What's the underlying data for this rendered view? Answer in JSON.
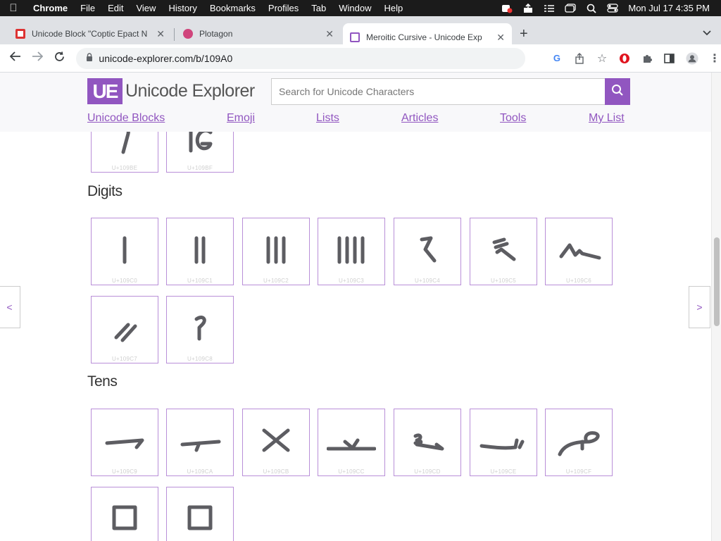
{
  "menubar": {
    "app_name": "Chrome",
    "items": [
      "File",
      "Edit",
      "View",
      "History",
      "Bookmarks",
      "Profiles",
      "Tab",
      "Window",
      "Help"
    ],
    "clock": "Mon Jul 17  4:35 PM"
  },
  "tabs": [
    {
      "title": "Unicode Block \"Coptic Epact N",
      "favicon_color": "#d33",
      "active": false
    },
    {
      "title": "Plotagon",
      "favicon_color": "#d0457c",
      "active": false
    },
    {
      "title": "Meroitic Cursive - Unicode Exp",
      "favicon_color": "#9156c0",
      "active": true
    }
  ],
  "toolbar": {
    "url": "unicode-explorer.com/b/109A0"
  },
  "site": {
    "logo_mark": "UE",
    "logo_text": "Unicode Explorer",
    "search_placeholder": "Search for Unicode Characters",
    "nav": [
      "Unicode Blocks",
      "Emoji",
      "Lists",
      "Articles",
      "Tools",
      "My List"
    ],
    "accent_color": "#9156c0"
  },
  "prev_row": {
    "cells": [
      {
        "code": "U+109BE",
        "glyph": "curl-p"
      },
      {
        "code": "U+109BF",
        "glyph": "ig"
      }
    ]
  },
  "digits": {
    "heading": "Digits",
    "cells": [
      {
        "code": "U+109C0",
        "glyph": "one"
      },
      {
        "code": "U+109C1",
        "glyph": "two"
      },
      {
        "code": "U+109C2",
        "glyph": "three"
      },
      {
        "code": "U+109C3",
        "glyph": "four"
      },
      {
        "code": "U+109C4",
        "glyph": "five"
      },
      {
        "code": "U+109C5",
        "glyph": "six"
      },
      {
        "code": "U+109C6",
        "glyph": "seven"
      },
      {
        "code": "U+109C7",
        "glyph": "eight"
      },
      {
        "code": "U+109C8",
        "glyph": "nine"
      }
    ]
  },
  "tens": {
    "heading": "Tens",
    "cells": [
      {
        "code": "U+109C9",
        "glyph": "ten"
      },
      {
        "code": "U+109CA",
        "glyph": "twenty"
      },
      {
        "code": "U+109CB",
        "glyph": "thirty"
      },
      {
        "code": "U+109CC",
        "glyph": "forty"
      },
      {
        "code": "U+109CD",
        "glyph": "fifty"
      },
      {
        "code": "U+109CE",
        "glyph": "sixty"
      },
      {
        "code": "U+109CF",
        "glyph": "seventy"
      },
      {
        "code": "",
        "glyph": "square"
      },
      {
        "code": "",
        "glyph": "square"
      }
    ]
  },
  "side_arrows": {
    "prev": "<",
    "next": ">"
  }
}
